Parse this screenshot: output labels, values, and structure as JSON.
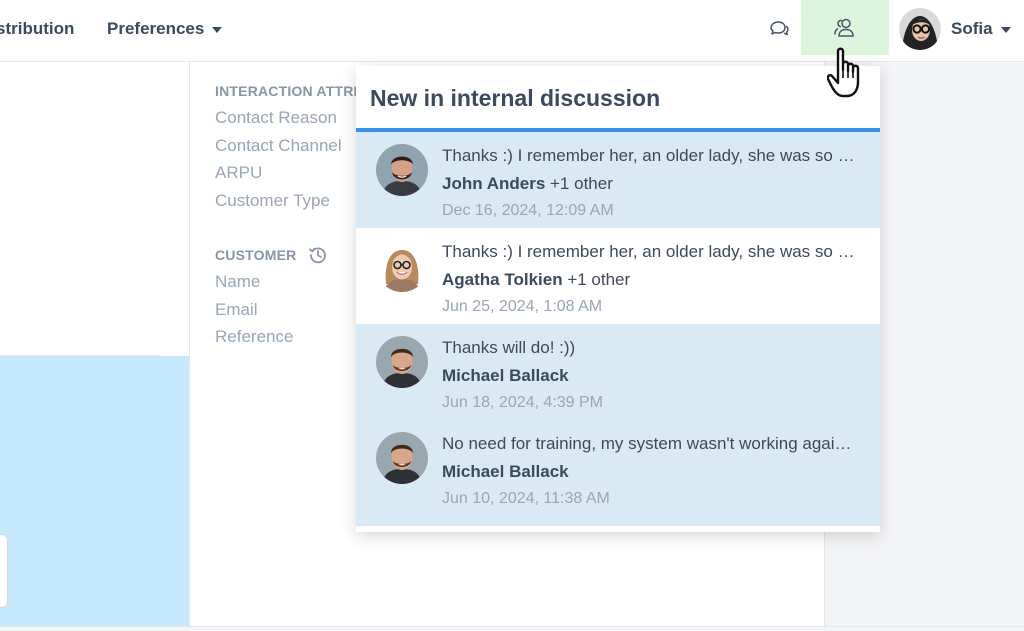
{
  "nav": {
    "distribution": "stribution",
    "preferences": "Preferences",
    "chat_icon": "chat-bubbles-icon",
    "internal_icon": "users-icon",
    "user_name": "Sofia"
  },
  "attributes": {
    "interaction_title": "INTERACTION ATTRIBUTES",
    "interaction_items": [
      "Contact Reason",
      "Contact Channel",
      "ARPU",
      "Customer Type"
    ],
    "customer_title": "CUSTOMER",
    "customer_items": [
      "Name",
      "Email",
      "Reference"
    ]
  },
  "popup": {
    "title": "New in internal discussion",
    "messages": [
      {
        "text": "Thanks :) I remember her, an older lady, she was so s…",
        "author": "John Anders",
        "extra": " +1 other",
        "date": "Dec 16, 2024, 12:09 AM",
        "unread": true
      },
      {
        "text": "Thanks :) I remember her, an older lady, she was so s…",
        "author": "Agatha Tolkien",
        "extra": " +1 other",
        "date": "Jun 25, 2024, 1:08 AM",
        "unread": false
      },
      {
        "text": "Thanks will do! :))",
        "author": "Michael Ballack",
        "extra": "",
        "date": "Jun 18, 2024, 4:39 PM",
        "unread": true
      },
      {
        "text": "No need for training, my system wasn't working agai…",
        "author": "Michael Ballack",
        "extra": "",
        "date": "Jun 10, 2024, 11:38 AM",
        "unread": true
      }
    ]
  },
  "colors": {
    "accent": "#3b8eea",
    "unread_bg": "#daeaf4",
    "active_button": "#dcf5dd"
  }
}
